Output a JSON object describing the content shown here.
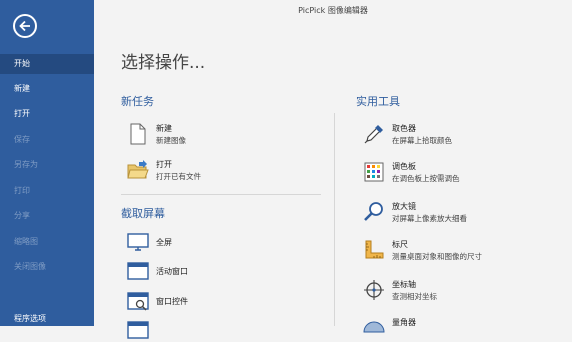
{
  "window": {
    "title": "PicPick 图像编辑器"
  },
  "sidebar": {
    "items": [
      {
        "label": "开始"
      },
      {
        "label": "新建"
      },
      {
        "label": "打开"
      },
      {
        "label": "保存"
      },
      {
        "label": "另存为"
      },
      {
        "label": "打印"
      },
      {
        "label": "分享"
      },
      {
        "label": "缩略图"
      },
      {
        "label": "关闭图像"
      },
      {
        "label": "程序选项"
      }
    ]
  },
  "main": {
    "title": "选择操作...",
    "new_task": {
      "heading": "新任务",
      "items": [
        {
          "label": "新建",
          "desc": "新建图像"
        },
        {
          "label": "打开",
          "desc": "打开已有文件"
        }
      ]
    },
    "capture": {
      "heading": "截取屏幕",
      "items": [
        {
          "label": "全屏"
        },
        {
          "label": "活动窗口"
        },
        {
          "label": "窗口控件"
        }
      ]
    },
    "tools": {
      "heading": "实用工具",
      "items": [
        {
          "label": "取色器",
          "desc": "在屏幕上拾取颜色"
        },
        {
          "label": "调色板",
          "desc": "在调色板上按需调色"
        },
        {
          "label": "放大镜",
          "desc": "对屏幕上像素放大细看"
        },
        {
          "label": "标尺",
          "desc": "测量桌面对象和图像的尺寸"
        },
        {
          "label": "坐标轴",
          "desc": "查测相对坐标"
        },
        {
          "label": "量角器"
        }
      ]
    }
  },
  "colors": {
    "sidebar": "#2f5d9e",
    "accent": "#2f5d9e"
  }
}
